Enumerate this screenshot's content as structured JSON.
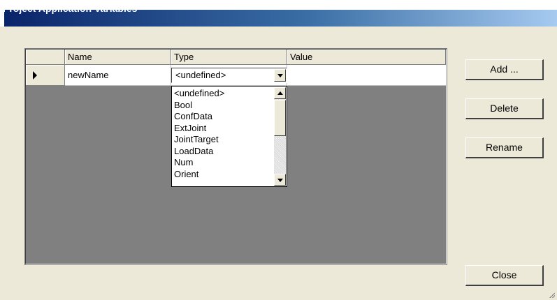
{
  "window": {
    "title": "Project Application Variables"
  },
  "grid": {
    "columns": [
      "Name",
      "Type",
      "Value"
    ],
    "rows": [
      {
        "name": "newName",
        "type": "<undefined>",
        "value": ""
      }
    ]
  },
  "type_combo": {
    "selected": "<undefined>",
    "options": [
      "<undefined>",
      "Bool",
      "ConfData",
      "ExtJoint",
      "JointTarget",
      "LoadData",
      "Num",
      "Orient"
    ]
  },
  "buttons": {
    "add": "Add ...",
    "delete": "Delete",
    "rename": "Rename",
    "close": "Close"
  },
  "icons": {
    "row_indicator": "triangle-right-icon",
    "dropdown": "chevron-down-icon",
    "scroll_up": "arrow-up-icon",
    "scroll_down": "arrow-down-icon",
    "size_grip": "resize-grip-icon"
  }
}
